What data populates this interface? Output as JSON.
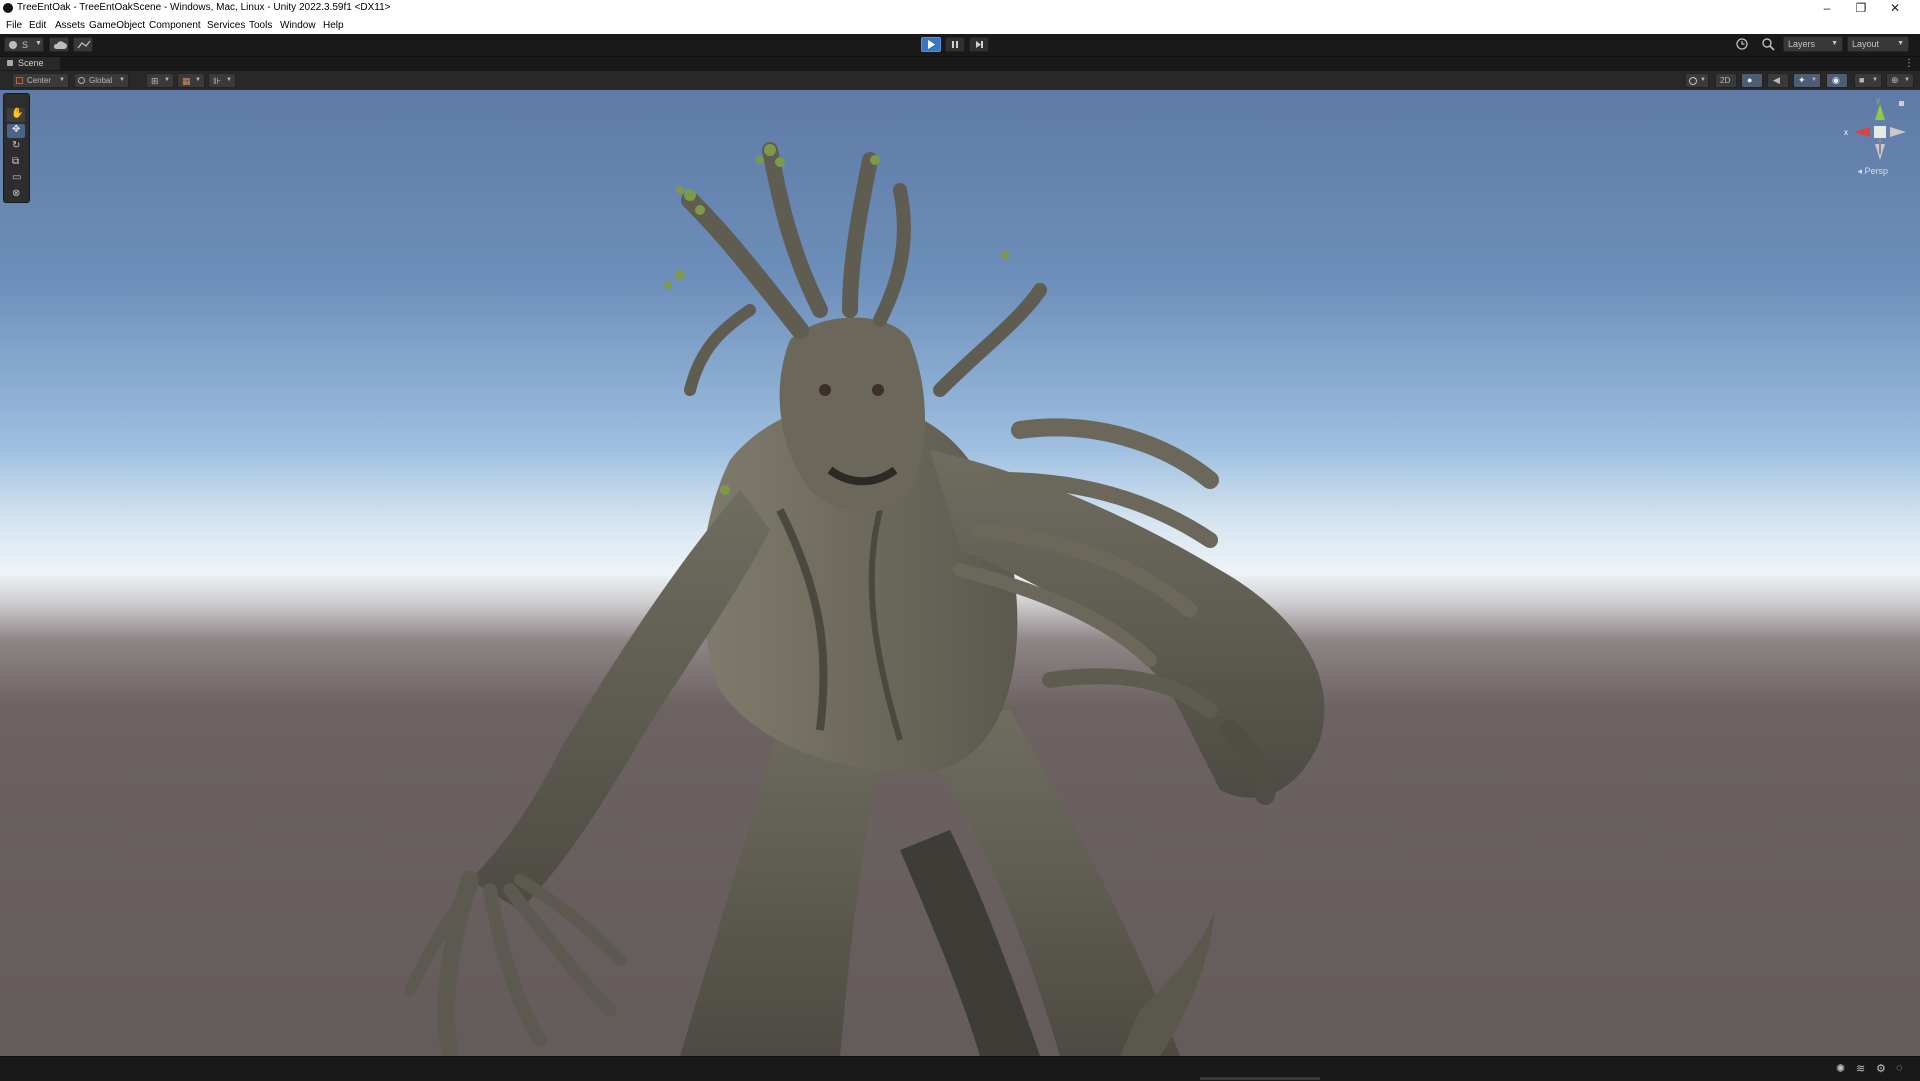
{
  "window": {
    "title": "TreeEntOak - TreeEntOakScene - Windows, Mac, Linux - Unity 2022.3.59f1 <DX11>",
    "controls": {
      "minimize": "–",
      "restore": "❐",
      "close": "✕"
    }
  },
  "menu": [
    "File",
    "Edit",
    "Assets",
    "GameObject",
    "Component",
    "Services",
    "Tools",
    "Window",
    "Help"
  ],
  "toolbar": {
    "account_label": "S",
    "play_state": "playing",
    "layers_label": "Layers",
    "layout_label": "Layout"
  },
  "scene_tab": {
    "label": "Scene"
  },
  "scene_toolbar": {
    "pivot_mode": "Center",
    "pivot_rotation": "Global",
    "mode_2d_label": "2D"
  },
  "tools": [
    "hand-tool-icon",
    "move-tool-icon",
    "rotate-tool-icon",
    "scale-tool-icon",
    "rect-tool-icon",
    "transform-tool-icon"
  ],
  "gizmo": {
    "x_label": "x",
    "y_label": "y",
    "projection_label": "Persp"
  },
  "colors": {
    "play_active": "#3a75c4",
    "axis_x": "#d9453c",
    "axis_y": "#8ecb3f",
    "axis_z": "#3d7bd8",
    "chrome_dark": "#191919",
    "panel": "#282828"
  }
}
